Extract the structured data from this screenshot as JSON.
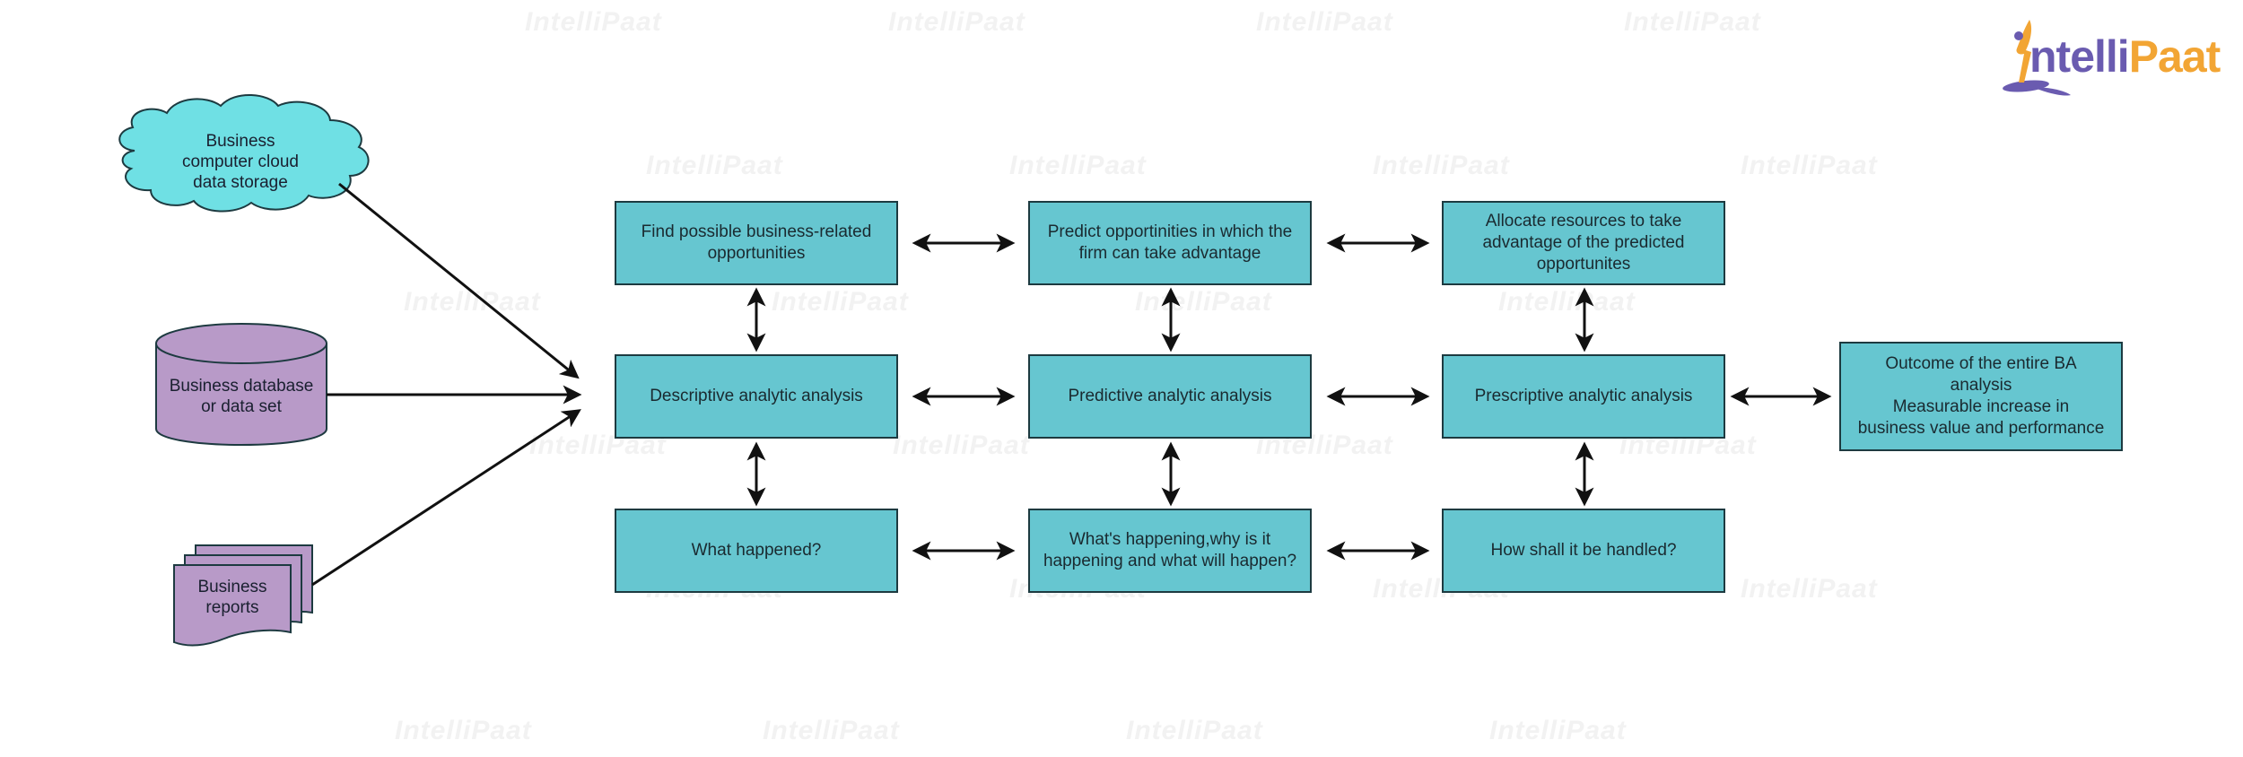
{
  "brand": {
    "logo_part1": "ntelli",
    "logo_part2": "Paat",
    "logo_initial": "I",
    "primary_color": "#6a5bb0",
    "accent_color": "#f2a534",
    "watermark_text": "IntelliPaat"
  },
  "colors": {
    "process_box_fill": "#66c6d0",
    "cloud_fill": "#6fe0e4",
    "source_fill": "#b89ac8",
    "stroke": "#1d3a40",
    "arrow": "#111111"
  },
  "sources": {
    "cloud": "Business computer cloud data storage",
    "cloud_lines": [
      "Business",
      "computer cloud",
      "data storage"
    ],
    "database_lines": [
      "Business database",
      "or data set"
    ],
    "reports_lines": [
      "Business",
      "reports"
    ]
  },
  "grid": {
    "top_row": [
      "Find possible business-related opportunities",
      "Predict opportinities in which the firm can take advantage",
      "Allocate resources to take advantage of the predicted opportunites"
    ],
    "middle_row": [
      "Descriptive analytic analysis",
      "Predictive analytic analysis",
      "Prescriptive analytic analysis"
    ],
    "bottom_row": [
      "What happened?",
      "What's happening,why is it happening and what will happen?",
      "How shall it be handled?"
    ]
  },
  "outcome": {
    "lines": [
      "Outcome of the entire BA analysis",
      "Measurable increase in",
      "business value and performance"
    ]
  },
  "connections": {
    "inputs_to": "Descriptive analytic analysis",
    "horizontal_bidirectional": true,
    "vertical_bidirectional": true
  }
}
